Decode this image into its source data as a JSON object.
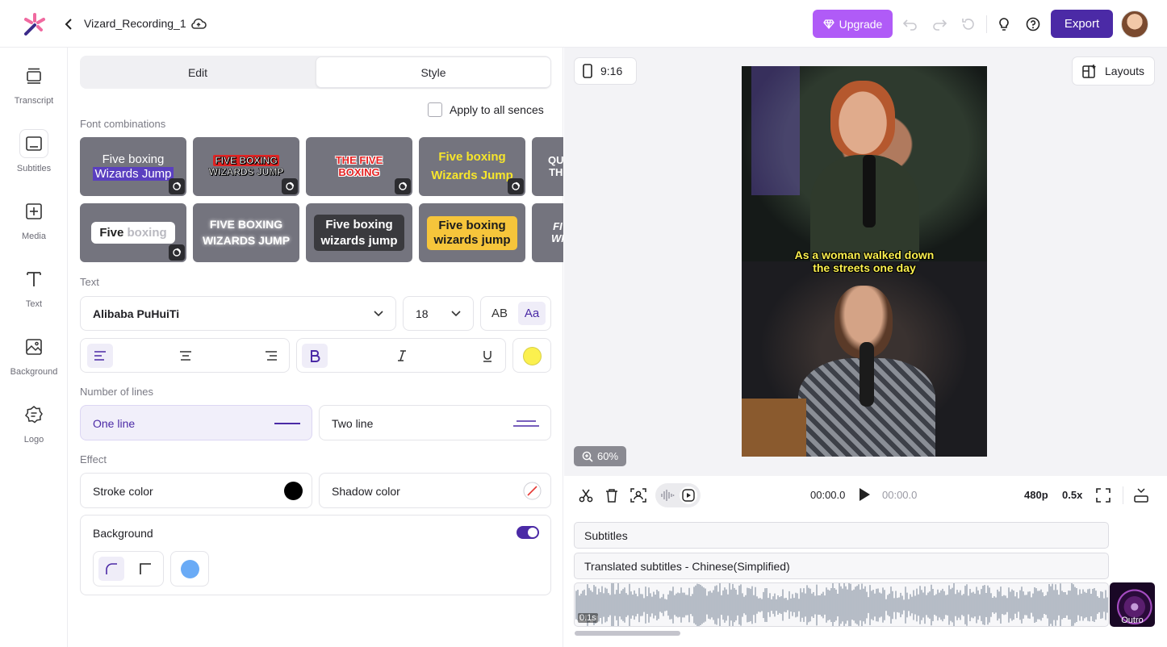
{
  "app": {
    "project_title": "Vizard_Recording_1"
  },
  "header": {
    "upgrade_label": "Upgrade",
    "export_label": "Export"
  },
  "rail": [
    {
      "label": "Transcript",
      "icon": "transcript-icon"
    },
    {
      "label": "Subtitles",
      "icon": "subtitles-icon"
    },
    {
      "label": "Media",
      "icon": "media-icon"
    },
    {
      "label": "Text",
      "icon": "text-icon"
    },
    {
      "label": "Background",
      "icon": "background-icon"
    },
    {
      "label": "Logo",
      "icon": "logo-icon"
    }
  ],
  "tabs": {
    "edit": "Edit",
    "style": "Style"
  },
  "apply_all": {
    "label": "Apply to all sences",
    "checked": false
  },
  "font_combinations": {
    "title": "Font combinations",
    "row1": [
      {
        "l1": "Five boxing",
        "l2": "Wizards Jump"
      },
      {
        "l1": "FIVE BOXING",
        "l2": "WIZARDS JUMP"
      },
      {
        "l1": "THE FIVE",
        "l2": "BOXING"
      },
      {
        "l1": "Five boxing",
        "l2": "Wizards Jump"
      },
      {
        "l1": "QU",
        "l2": "TH"
      }
    ],
    "row2": [
      {
        "l1": "Five",
        "l2": "boxing"
      },
      {
        "l1": "FIVE BOXING",
        "l2": "WIZARDS JUMP"
      },
      {
        "l1": "Five boxing",
        "l2": "wizards jump"
      },
      {
        "l1": "Five boxing",
        "l2": "wizards jump"
      },
      {
        "l1": "FI",
        "l2": "WI"
      }
    ]
  },
  "text_section": {
    "title": "Text",
    "font_family": "Alibaba PuHuiTi",
    "font_size": "18",
    "case_upper": "AB",
    "case_mixed": "Aa",
    "color": "#fbf04e"
  },
  "lines": {
    "title": "Number of lines",
    "one": "One line",
    "two": "Two line",
    "selected": "one"
  },
  "effect": {
    "title": "Effect",
    "stroke": "Stroke color",
    "shadow": "Shadow color",
    "stroke_color": "#000000"
  },
  "background": {
    "label": "Background",
    "enabled": true,
    "swatch": "#6aabf6"
  },
  "preview": {
    "ratio": "9:16",
    "layouts": "Layouts",
    "zoom": "60%",
    "caption_l1": "As a woman walked down",
    "caption_l2": "the streets one day"
  },
  "playback": {
    "current": "00:00.0",
    "total": "00:00.0",
    "quality": "480p",
    "speed": "0.5x"
  },
  "timeline": {
    "track1": "Subtitles",
    "track2": "Translated subtitles - Chinese(Simplified)",
    "clip_time": "0.1s",
    "outro": "Outro"
  },
  "colors": {
    "accent": "#4b2aa6",
    "upgrade": "#b05bf7",
    "caption": "#fbf04e"
  }
}
